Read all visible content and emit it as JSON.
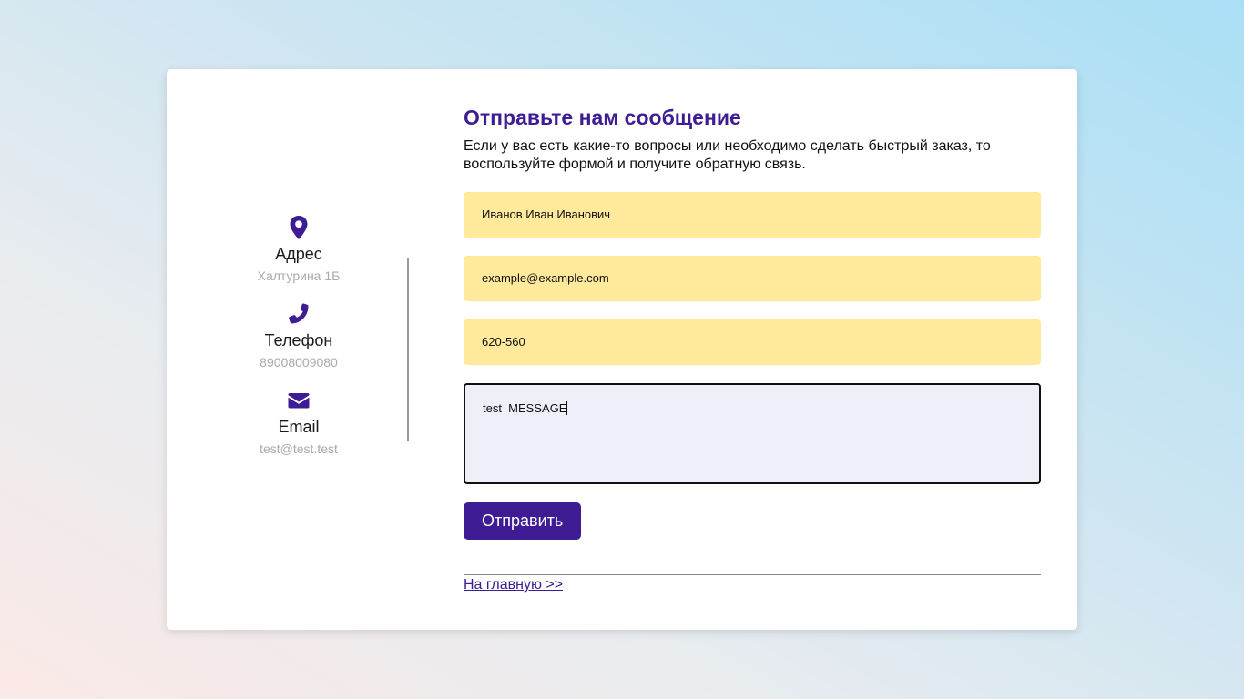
{
  "contacts": [
    {
      "icon": "map-marker-icon",
      "title": "Адрес",
      "value": "Халтурина 1Б"
    },
    {
      "icon": "phone-icon",
      "title": "Телефон",
      "value": "89008009080"
    },
    {
      "icon": "envelope-icon",
      "title": "Email",
      "value": "test@test.test"
    }
  ],
  "form": {
    "title": "Отправьте нам сообщение",
    "description": "Если у вас есть какие-то вопросы или необходимо сделать быстрый заказ, то воспользуйте формой и получите обратную связь.",
    "name_value": "Иванов Иван Иванович",
    "email_value": "example@example.com",
    "phone_value": "620-560",
    "message_value": "test  MESSAGE",
    "submit_label": "Отправить",
    "home_link_label": "На главную >>"
  },
  "colors": {
    "accent": "#3e1d94",
    "field_background": "#ffe99a",
    "message_background": "#eeeff8",
    "muted_text": "#aaaaaa"
  }
}
